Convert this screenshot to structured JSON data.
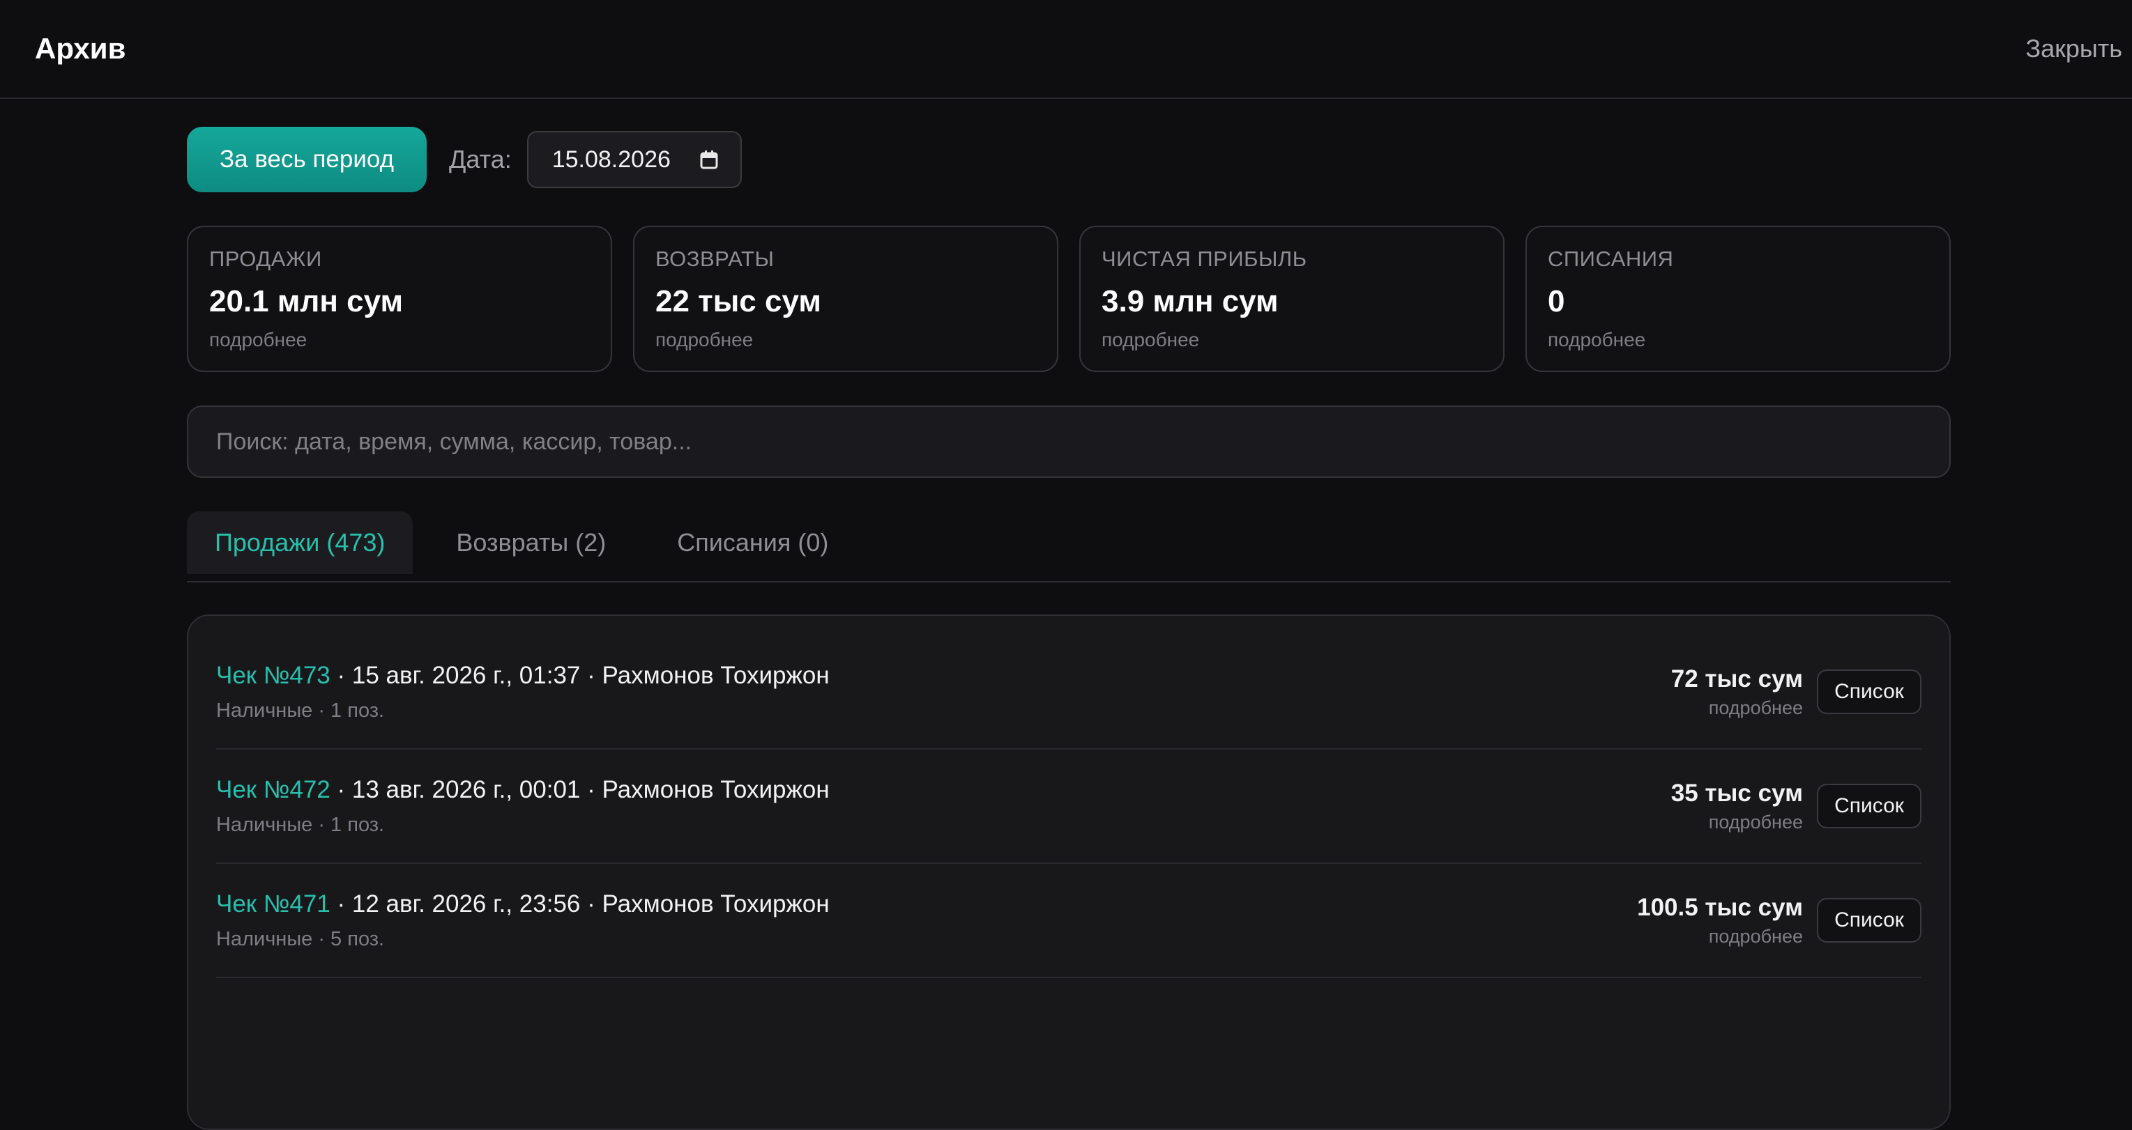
{
  "header": {
    "title": "Архив",
    "close_label": "Закрыть"
  },
  "toolbar": {
    "period_label": "За весь период",
    "date_label": "Дата:",
    "date_value": "15.08.2026"
  },
  "cards": [
    {
      "label": "ПРОДАЖИ",
      "value": "20.1 млн сум",
      "link": "подробнее"
    },
    {
      "label": "ВОЗВРАТЫ",
      "value": "22 тыс сум",
      "link": "подробнее"
    },
    {
      "label": "ЧИСТАЯ ПРИБЫЛЬ",
      "value": "3.9 млн сум",
      "link": "подробнее"
    },
    {
      "label": "СПИСАНИЯ",
      "value": "0",
      "link": "подробнее"
    }
  ],
  "search": {
    "placeholder": "Поиск: дата, время, сумма, кассир, товар..."
  },
  "tabs": [
    {
      "label": "Продажи (473)"
    },
    {
      "label": "Возвраты (2)"
    },
    {
      "label": "Списания (0)"
    }
  ],
  "receipts": [
    {
      "number": "Чек №473",
      "details": " · 15 авг. 2026 г., 01:37 · Рахмонов Тохиржон",
      "sub": "Наличные · 1 поз.",
      "amount": "72 тыс сум",
      "link": "подробнее",
      "button": "Список"
    },
    {
      "number": "Чек №472",
      "details": " · 13 авг. 2026 г., 00:01 · Рахмонов Тохиржон",
      "sub": "Наличные · 1 поз.",
      "amount": "35 тыс сум",
      "link": "подробнее",
      "button": "Список"
    },
    {
      "number": "Чек №471",
      "details": " · 12 авг. 2026 г., 23:56 · Рахмонов Тохиржон",
      "sub": "Наличные · 5 поз.",
      "amount": "100.5 тыс сум",
      "link": "подробнее",
      "button": "Список"
    }
  ],
  "colors": {
    "accent": "#26c0ae",
    "button": "#0e8b82",
    "background": "#0e0e10"
  }
}
